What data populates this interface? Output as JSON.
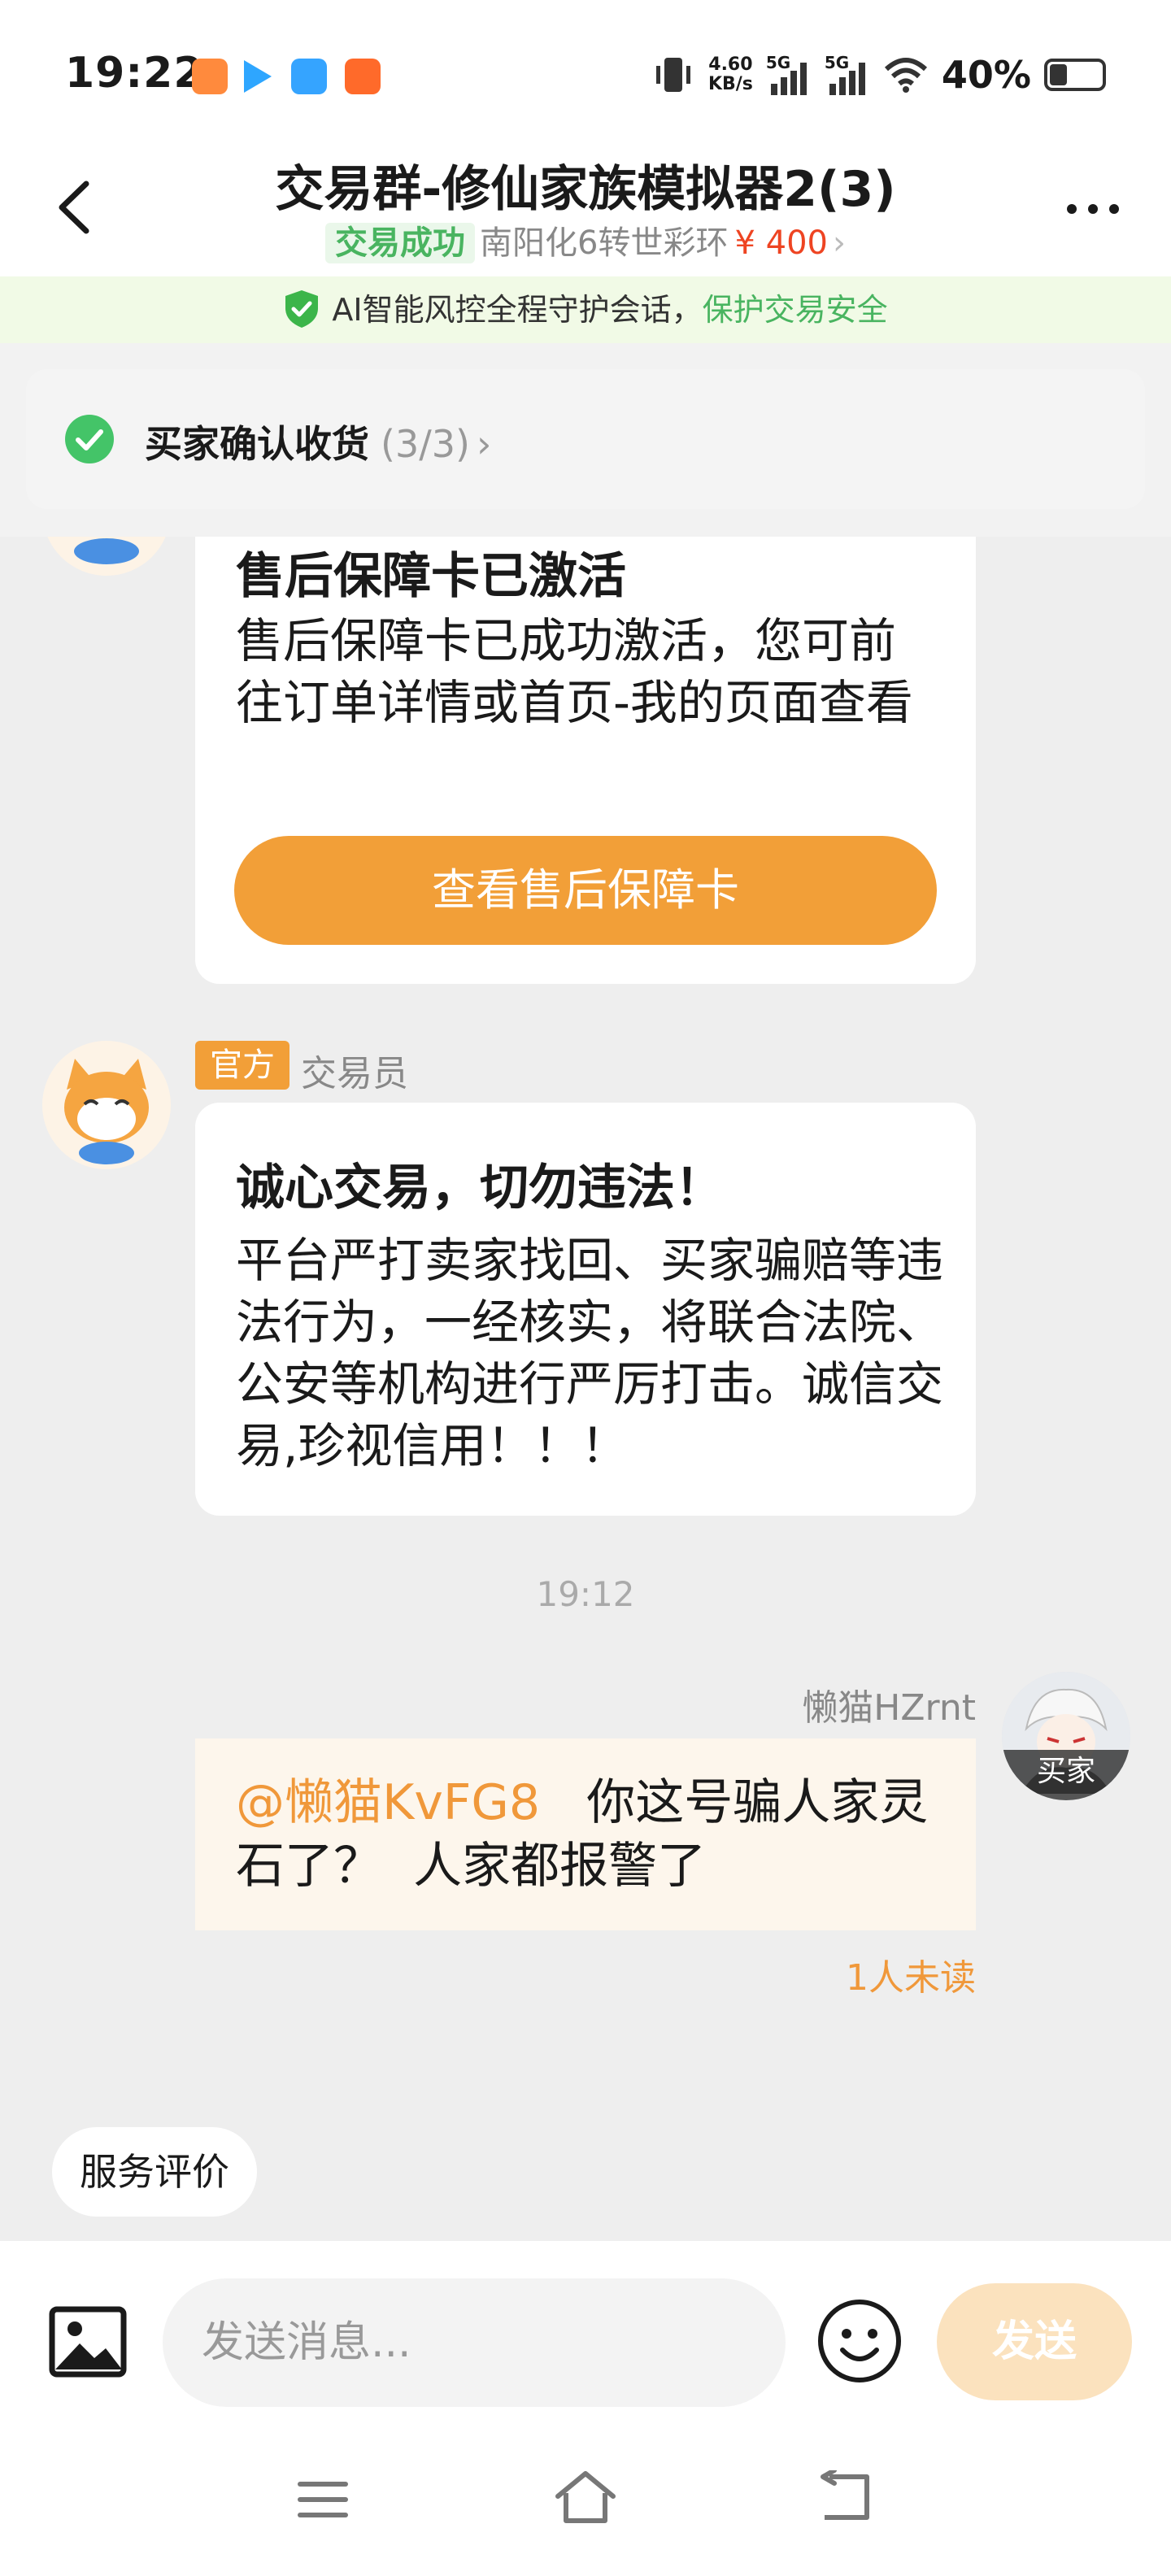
{
  "status_bar": {
    "time": "19:22",
    "net_speed_value": "4.60",
    "net_speed_unit": "KB/s",
    "sig1": "5G",
    "sig2": "5G",
    "battery_text": "40%",
    "battery_level": 0.4
  },
  "header": {
    "title": "交易群-修仙家族模拟器2(3)",
    "trade_status": "交易成功",
    "order_item": "南阳化6转世彩环",
    "order_price": "¥ 400",
    "order_chevron": "›"
  },
  "ai_banner": {
    "text_a": "AI智能风控全程守护会话，",
    "text_b": "保护交易安全"
  },
  "confirm_card": {
    "label": "买家确认收货",
    "count": "(3/3)",
    "chevron": "›"
  },
  "messages": {
    "card1": {
      "title": "售后保障卡已激活",
      "body": "售后保障卡已成功激活，您可前往订单详情或首页-我的页面查看",
      "button": "查看售后保障卡"
    },
    "official": {
      "tag": "官方",
      "sender": "交易员",
      "title": "诚心交易，切勿违法！",
      "body": "平台严打卖家找回、买家骗赔等违法行为，一经核实，将联合法院、公安等机构进行严厉打击。诚信交易,珍视信用！！！"
    },
    "time_divider": "19:12",
    "buyer": {
      "name": "懒猫HZrnt",
      "badge": "买家",
      "mention": "@懒猫KvFG8",
      "text": "   你这号骗人家灵石了？  人家都报警了",
      "unread": "1人未读"
    }
  },
  "rate_button": "服务评价",
  "input_bar": {
    "placeholder": "发送消息...",
    "send": "发送"
  },
  "colors": {
    "accent": "#f29f38",
    "success": "#49b460",
    "price": "#ee4422"
  }
}
